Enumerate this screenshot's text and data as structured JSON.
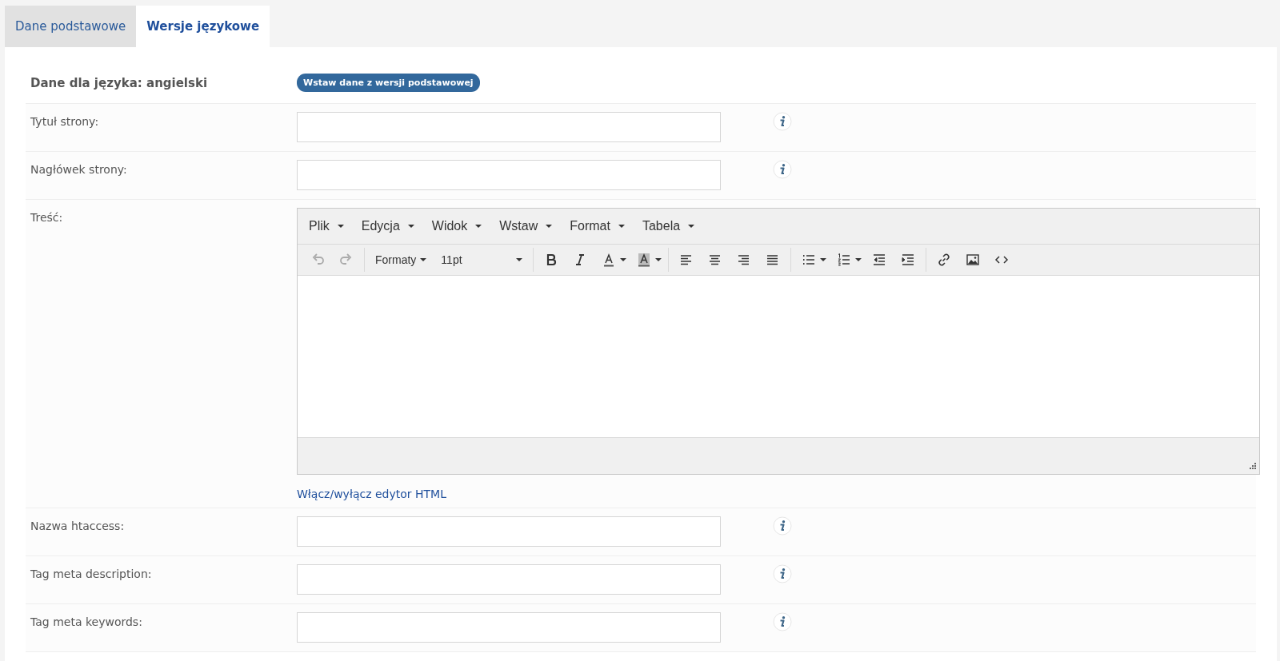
{
  "tabs": [
    {
      "label": "Dane podstawowe",
      "selected": false
    },
    {
      "label": "Wersje językowe",
      "selected": true
    }
  ],
  "language_header": {
    "label": "Dane dla języka: angielski",
    "button": "Wstaw dane z wersji podstawowej"
  },
  "fields": [
    {
      "kind": "input",
      "label": "Tytuł strony:",
      "info": true
    },
    {
      "kind": "input",
      "label": "Nagłówek strony:",
      "info": true
    },
    {
      "kind": "editor",
      "label": "Treść:",
      "info": false
    },
    {
      "kind": "input",
      "label": "Nazwa htaccess:",
      "info": true
    },
    {
      "kind": "input",
      "label": "Tag meta description:",
      "info": true
    },
    {
      "kind": "input",
      "label": "Tag meta keywords:",
      "info": true
    }
  ],
  "editor": {
    "menu": [
      "Plik",
      "Edycja",
      "Widok",
      "Wstaw",
      "Format",
      "Tabela"
    ],
    "toolbar": [
      [
        {
          "kind": "undo",
          "disabled": true
        },
        {
          "kind": "redo",
          "disabled": true
        }
      ],
      [
        {
          "kind": "dropdown",
          "label": "Formaty",
          "disabled": false
        },
        {
          "kind": "select",
          "label": "11pt",
          "disabled": false
        }
      ],
      [
        {
          "kind": "bold",
          "disabled": false
        },
        {
          "kind": "italic",
          "disabled": false
        },
        {
          "kind": "forecolor",
          "disabled": false
        },
        {
          "kind": "backcolor",
          "disabled": false
        }
      ],
      [
        {
          "kind": "align-left",
          "disabled": false
        },
        {
          "kind": "align-center",
          "disabled": false
        },
        {
          "kind": "align-right",
          "disabled": false
        },
        {
          "kind": "justify",
          "disabled": false
        }
      ],
      [
        {
          "kind": "bullet-list",
          "disabled": false
        },
        {
          "kind": "numbered-list",
          "disabled": false
        },
        {
          "kind": "outdent",
          "disabled": false
        },
        {
          "kind": "indent",
          "disabled": false
        }
      ],
      [
        {
          "kind": "link",
          "disabled": false
        },
        {
          "kind": "image",
          "disabled": false
        },
        {
          "kind": "code",
          "disabled": false
        }
      ]
    ],
    "html_toggle": "Włącz/wyłącz edytor HTML"
  }
}
